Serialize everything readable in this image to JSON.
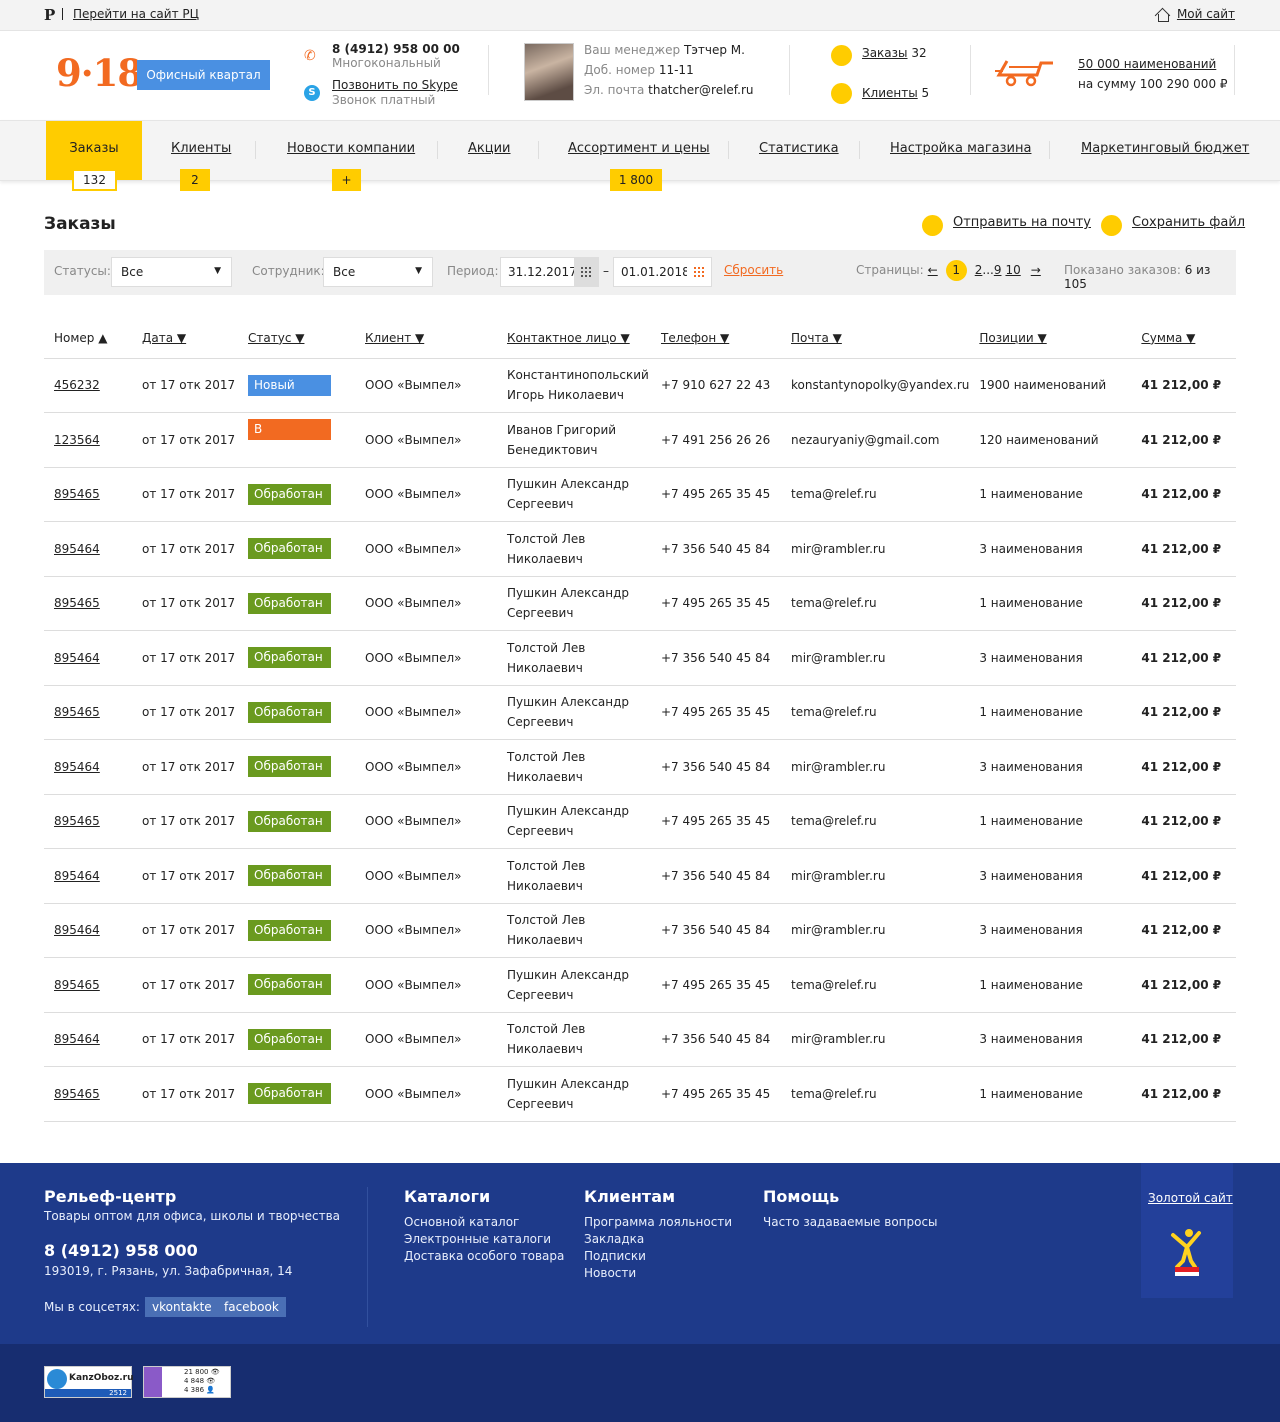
{
  "topbar": {
    "brand_letter": "Р",
    "go_site": "Перейти на сайт РЦ",
    "my_site": "Мой сайт"
  },
  "header": {
    "logo": "9·18",
    "quarter_button": "Офисный квартал",
    "phone": "8 (4912) 958 00 00",
    "phone_sub": "Многокональный",
    "skype": "Позвонить по Skype",
    "skype_sub": "Звонок платный",
    "manager": {
      "name_label": "Ваш менеджер",
      "name": "Тэтчер М.",
      "ext_label": "Доб. номер",
      "ext": "11-11",
      "email_label": "Эл. почта",
      "email": "thatcher@relef.ru"
    },
    "orders_link": "Заказы",
    "orders_count": "32",
    "clients_link": "Клиенты",
    "clients_count": "5",
    "assortment_link": "50 000 наименований",
    "assortment_sum": "на сумму 100 290 000 ₽",
    "accent": "#f26a21"
  },
  "nav": {
    "items": [
      "Заказы",
      "Клиенты",
      "Новости компании",
      "Акции",
      "Ассортимент и цены",
      "Статистика",
      "Настройка магазина",
      "Маркетинговый бюджет"
    ],
    "badges": [
      "132",
      "2",
      "+",
      "1 800"
    ],
    "active_color": "#ffcc00"
  },
  "page": {
    "title": "Заказы",
    "send_mail": "Отправить на почту",
    "save_file": "Сохранить файл"
  },
  "filters": {
    "status_label": "Статусы:",
    "status_value": "Все",
    "employee_label": "Сотрудник:",
    "employee_value": "Все",
    "period_label": "Период:",
    "date_from": "31.12.2017",
    "dash": "–",
    "date_to": "01.01.2018",
    "reset": "Сбросить",
    "pages_label": "Страницы:",
    "prev": "←",
    "current_page": "1",
    "page2": "2",
    "ellipsis": "...",
    "page9": "9",
    "page10": "10",
    "next": "→",
    "shown_label": "Показано заказов:",
    "shown_value": "6 из 105"
  },
  "table": {
    "headers": [
      "Номер ▲",
      "Дата ▼",
      "Статус ▼",
      "Клиент ▼",
      "Контактное лицо ▼",
      "Телефон ▼",
      "Почта ▼",
      "Позиции ▼",
      "Сумма ▼"
    ],
    "rows": [
      {
        "num": "456232",
        "date": "от 17 отк 2017",
        "status": "Новый",
        "type": "new",
        "client": "ООО «Вымпел»",
        "contact1": "Константинопольский",
        "contact2": "Игорь Николаевич",
        "phone": "+7 910 627 22 43",
        "email": "konstantynopolky@yandex.ru",
        "items": "1900 наименований",
        "sum": "41 212,00 ₽"
      },
      {
        "num": "123564",
        "date": "от 17 отк 2017",
        "status": "В обработке",
        "type": "proc",
        "client": "ООО «Вымпел»",
        "contact1": "Иванов Григорий",
        "contact2": "Бенедиктович",
        "phone": "+7 491 256 26 26",
        "email": "nezauryaniy@gmail.com",
        "items": "120 наименований",
        "sum": "41 212,00 ₽"
      },
      {
        "num": "895465",
        "date": "от 17 отк 2017",
        "status": "Обработан",
        "type": "done",
        "client": "ООО «Вымпел»",
        "contact1": "Пушкин Александр",
        "contact2": "Сергеевич",
        "phone": "+7 495 265 35 45",
        "email": "tema@relef.ru",
        "items": "1 наименование",
        "sum": "41 212,00 ₽"
      },
      {
        "num": "895464",
        "date": "от 17 отк 2017",
        "status": "Обработан",
        "type": "done",
        "client": "ООО «Вымпел»",
        "contact1": "Толстой Лев",
        "contact2": "Николаевич",
        "phone": "+7 356 540 45 84",
        "email": "mir@rambler.ru",
        "items": "3 наименования",
        "sum": "41 212,00 ₽"
      },
      {
        "num": "895465",
        "date": "от 17 отк 2017",
        "status": "Обработан",
        "type": "done",
        "client": "ООО «Вымпел»",
        "contact1": "Пушкин Александр",
        "contact2": "Сергеевич",
        "phone": "+7 495 265 35 45",
        "email": "tema@relef.ru",
        "items": "1 наименование",
        "sum": "41 212,00 ₽"
      },
      {
        "num": "895464",
        "date": "от 17 отк 2017",
        "status": "Обработан",
        "type": "done",
        "client": "ООО «Вымпел»",
        "contact1": "Толстой Лев",
        "contact2": "Николаевич",
        "phone": "+7 356 540 45 84",
        "email": "mir@rambler.ru",
        "items": "3 наименования",
        "sum": "41 212,00 ₽"
      },
      {
        "num": "895465",
        "date": "от 17 отк 2017",
        "status": "Обработан",
        "type": "done",
        "client": "ООО «Вымпел»",
        "contact1": "Пушкин Александр",
        "contact2": "Сергеевич",
        "phone": "+7 495 265 35 45",
        "email": "tema@relef.ru",
        "items": "1 наименование",
        "sum": "41 212,00 ₽"
      },
      {
        "num": "895464",
        "date": "от 17 отк 2017",
        "status": "Обработан",
        "type": "done",
        "client": "ООО «Вымпел»",
        "contact1": "Толстой Лев",
        "contact2": "Николаевич",
        "phone": "+7 356 540 45 84",
        "email": "mir@rambler.ru",
        "items": "3 наименования",
        "sum": "41 212,00 ₽"
      },
      {
        "num": "895465",
        "date": "от 17 отк 2017",
        "status": "Обработан",
        "type": "done",
        "client": "ООО «Вымпел»",
        "contact1": "Пушкин Александр",
        "contact2": "Сергеевич",
        "phone": "+7 495 265 35 45",
        "email": "tema@relef.ru",
        "items": "1 наименование",
        "sum": "41 212,00 ₽"
      },
      {
        "num": "895464",
        "date": "от 17 отк 2017",
        "status": "Обработан",
        "type": "done",
        "client": "ООО «Вымпел»",
        "contact1": "Толстой Лев",
        "contact2": "Николаевич",
        "phone": "+7 356 540 45 84",
        "email": "mir@rambler.ru",
        "items": "3 наименования",
        "sum": "41 212,00 ₽"
      },
      {
        "num": "895464",
        "date": "от 17 отк 2017",
        "status": "Обработан",
        "type": "done",
        "client": "ООО «Вымпел»",
        "contact1": "Толстой Лев",
        "contact2": "Николаевич",
        "phone": "+7 356 540 45 84",
        "email": "mir@rambler.ru",
        "items": "3 наименования",
        "sum": "41 212,00 ₽"
      },
      {
        "num": "895465",
        "date": "от 17 отк 2017",
        "status": "Обработан",
        "type": "done",
        "client": "ООО «Вымпел»",
        "contact1": "Пушкин Александр",
        "contact2": "Сергеевич",
        "phone": "+7 495 265 35 45",
        "email": "tema@relef.ru",
        "items": "1 наименование",
        "sum": "41 212,00 ₽"
      },
      {
        "num": "895464",
        "date": "от 17 отк 2017",
        "status": "Обработан",
        "type": "done",
        "client": "ООО «Вымпел»",
        "contact1": "Толстой Лев",
        "contact2": "Николаевич",
        "phone": "+7 356 540 45 84",
        "email": "mir@rambler.ru",
        "items": "3 наименования",
        "sum": "41 212,00 ₽"
      },
      {
        "num": "895465",
        "date": "от 17 отк 2017",
        "status": "Обработан",
        "type": "done",
        "client": "ООО «Вымпел»",
        "contact1": "Пушкин Александр",
        "contact2": "Сергеевич",
        "phone": "+7 495 265 35 45",
        "email": "tema@relef.ru",
        "items": "1 наименование",
        "sum": "41 212,00 ₽"
      }
    ],
    "status_colors": {
      "new": "#4a90e2",
      "proc": "#f26a21",
      "done": "#6a9a1f"
    }
  },
  "footer": {
    "company": "Рельеф-центр",
    "tagline": "Товары оптом для офиса, школы и творчества",
    "phone": "8 (4912) 958 000",
    "address": "193019, г. Рязань,  ул. Зафабричная, 14",
    "social_label": "Мы в соцсетях:",
    "social": [
      "vkontakte",
      "facebook"
    ],
    "catalogs_title": "Каталоги",
    "catalogs": [
      "Основной каталог",
      "Электронные каталоги",
      "Доставка особого товара"
    ],
    "clients_title": "Клиентам",
    "clients": [
      "Программа лояльности",
      "Закладка",
      "Подписки",
      "Новости"
    ],
    "help_title": "Помощь",
    "help": [
      "Часто задаваемые вопросы"
    ],
    "gold_site": "Золотой сайт",
    "counter1_name": "KanzOboz.ru",
    "counter1_value": "2512",
    "counter2_lines": [
      "21 800 👁",
      "4 848 👁",
      "4 386 👤"
    ],
    "bg": "#1e3a8a"
  }
}
